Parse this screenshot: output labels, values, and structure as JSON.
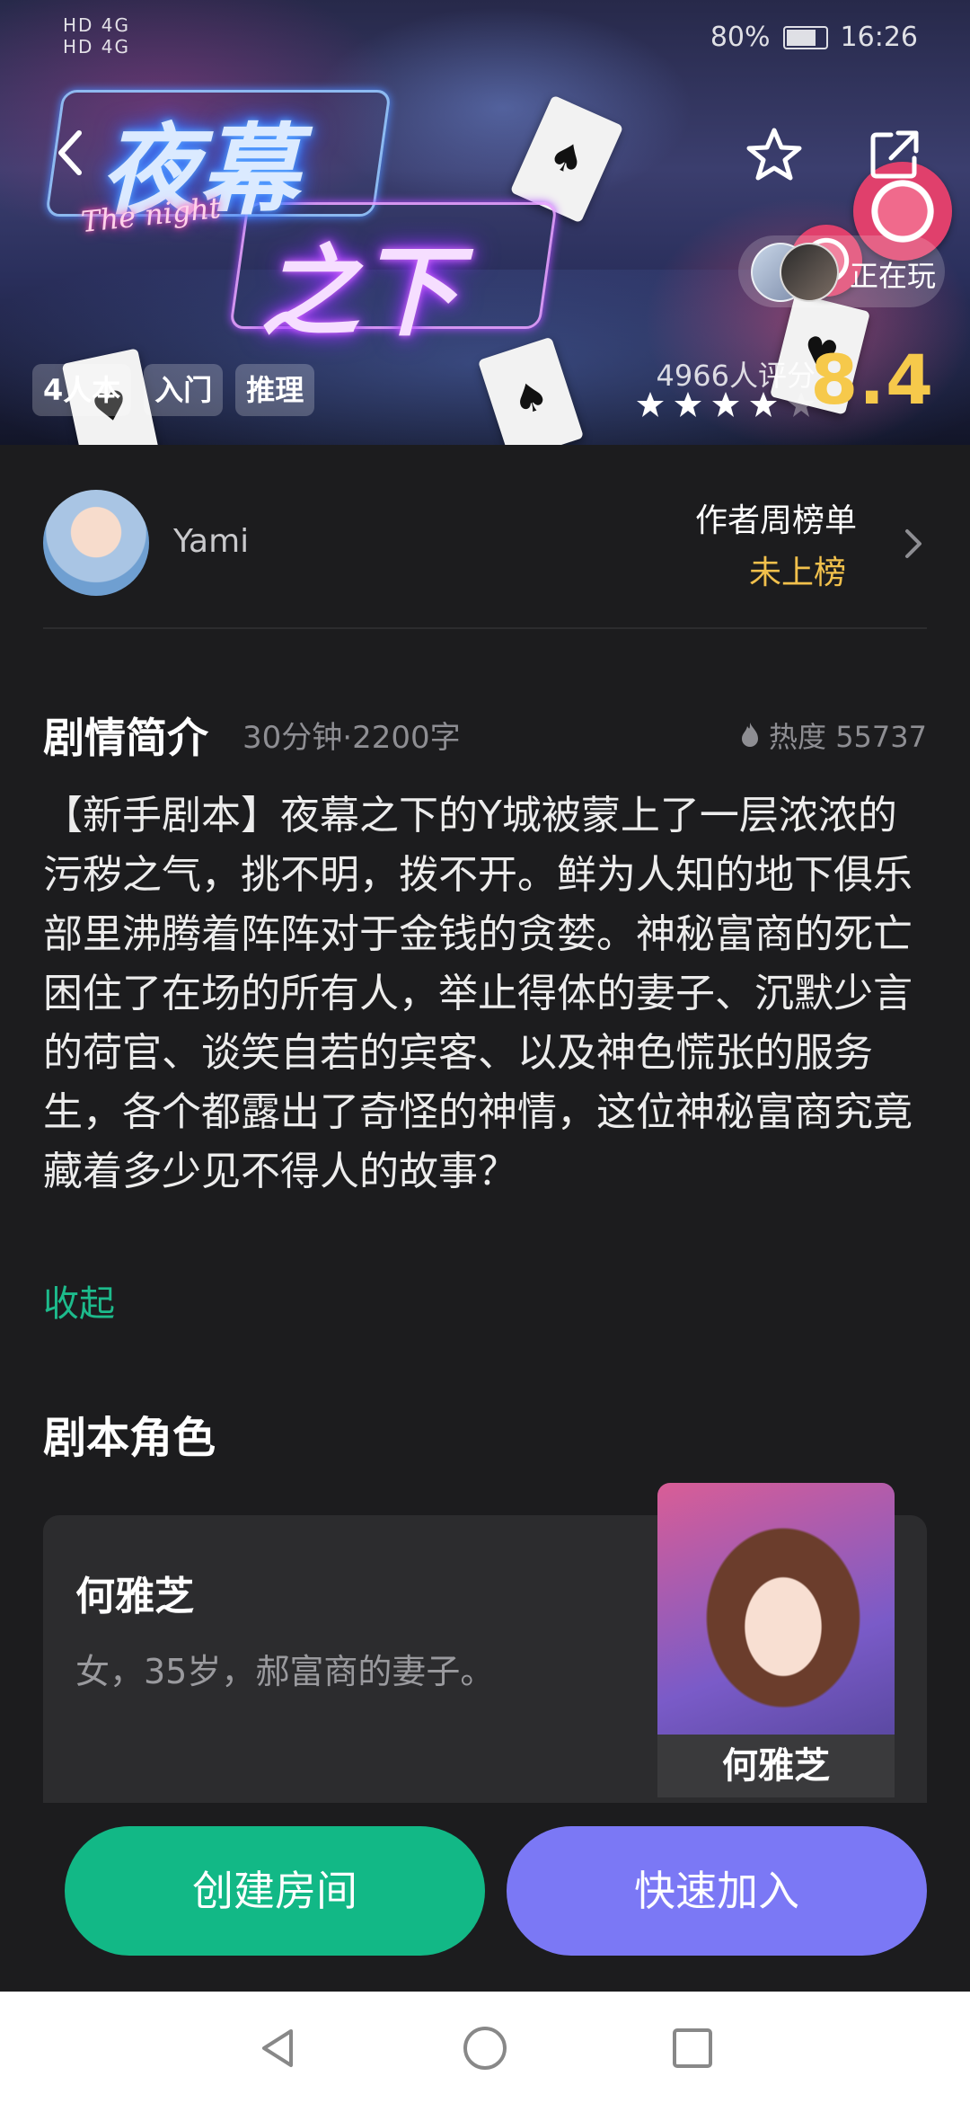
{
  "status_bar": {
    "left_indicators": [
      "HD 4G",
      "HD 4G"
    ],
    "battery": "80%",
    "time": "16:26"
  },
  "hero": {
    "logo_line1": "夜幕",
    "logo_line2": "之下",
    "logo_subtitle": "The night",
    "now_playing": "正在玩",
    "tags": [
      "4人本",
      "入门",
      "推理"
    ],
    "rating_count": "4966人评分",
    "score": "8.4",
    "stars_filled": 4,
    "stars_total": 5,
    "accent_score_color": "#f6c94b"
  },
  "author": {
    "name": "Yami",
    "weekly_label": "作者周榜单",
    "rank_status": "未上榜"
  },
  "synopsis": {
    "title": "剧情简介",
    "meta": "30分钟·2200字",
    "heat": "热度 55737",
    "text": "【新手剧本】夜幕之下的Y城被蒙上了一层浓浓的污秽之气，挑不明，拨不开。鲜为人知的地下俱乐部里沸腾着阵阵对于金钱的贪婪。神秘富商的死亡困住了在场的所有人，举止得体的妻子、沉默少言的荷官、谈笑自若的宾客、以及神色慌张的服务生，各个都露出了奇怪的神情，这位神秘富商究竟藏着多少见不得人的故事？",
    "collapse_label": "收起"
  },
  "roles": {
    "title": "剧本角色",
    "items": [
      {
        "name": "何雅芝",
        "description": "女，35岁，郝富商的妻子。",
        "portrait_label": "何雅芝"
      }
    ]
  },
  "actions": {
    "create_room": "创建房间",
    "quick_join": "快速加入",
    "create_color": "#12b886",
    "join_color": "#7b78f5"
  },
  "nav": {
    "icons": [
      "back-triangle-icon",
      "home-circle-icon",
      "recent-square-icon"
    ]
  }
}
